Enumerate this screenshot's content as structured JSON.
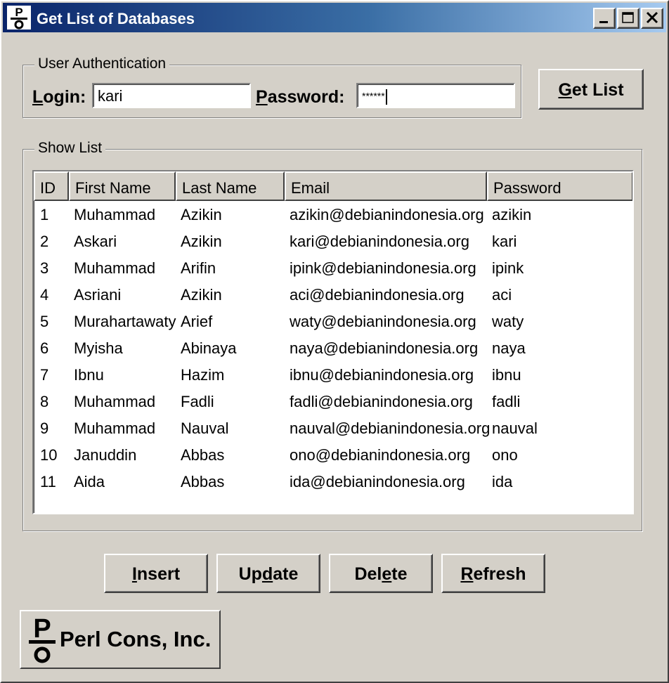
{
  "window": {
    "title": "Get List of Databases",
    "controls": {
      "minimize": "minimize-icon",
      "maximize": "maximize-icon",
      "close": "close-icon"
    }
  },
  "auth": {
    "legend": "User Authentication",
    "login_label": "Login:",
    "login_value": "kari",
    "password_label": "Password:",
    "password_value": "******",
    "get_list_label": "Get List"
  },
  "list": {
    "legend": "Show List",
    "columns": [
      "ID",
      "First Name",
      "Last Name",
      "Email",
      "Password"
    ],
    "rows": [
      [
        "1",
        "Muhammad",
        "Azikin",
        "azikin@debianindonesia.org",
        "azikin"
      ],
      [
        "2",
        "Askari",
        "Azikin",
        "kari@debianindonesia.org",
        "kari"
      ],
      [
        "3",
        "Muhammad",
        "Arifin",
        "ipink@debianindonesia.org",
        "ipink"
      ],
      [
        "4",
        "Asriani",
        "Azikin",
        "aci@debianindonesia.org",
        "aci"
      ],
      [
        "5",
        "Murahartawaty",
        "Arief",
        "waty@debianindonesia.org",
        "waty"
      ],
      [
        "6",
        "Myisha",
        "Abinaya",
        "naya@debianindonesia.org",
        "naya"
      ],
      [
        "7",
        "Ibnu",
        "Hazim",
        "ibnu@debianindonesia.org",
        "ibnu"
      ],
      [
        "8",
        "Muhammad",
        "Fadli",
        "fadli@debianindonesia.org",
        "fadli"
      ],
      [
        "9",
        "Muhammad",
        "Nauval",
        "nauval@debianindonesia.org",
        "nauval"
      ],
      [
        "10",
        "Januddin",
        "Abbas",
        "ono@debianindonesia.org",
        "ono"
      ],
      [
        "11",
        "Aida",
        "Abbas",
        "ida@debianindonesia.org",
        "ida"
      ]
    ]
  },
  "actions": {
    "insert_label": "Insert",
    "update_label": "Update",
    "delete_label": "Delete",
    "refresh_label": "Refresh"
  },
  "logo": {
    "text": "Perl Cons, Inc.",
    "icon": "perl-cons-logo-icon"
  },
  "colors": {
    "titlebar_start": "#0a246a",
    "titlebar_end": "#a6caf0",
    "face": "#d4d0c8"
  }
}
